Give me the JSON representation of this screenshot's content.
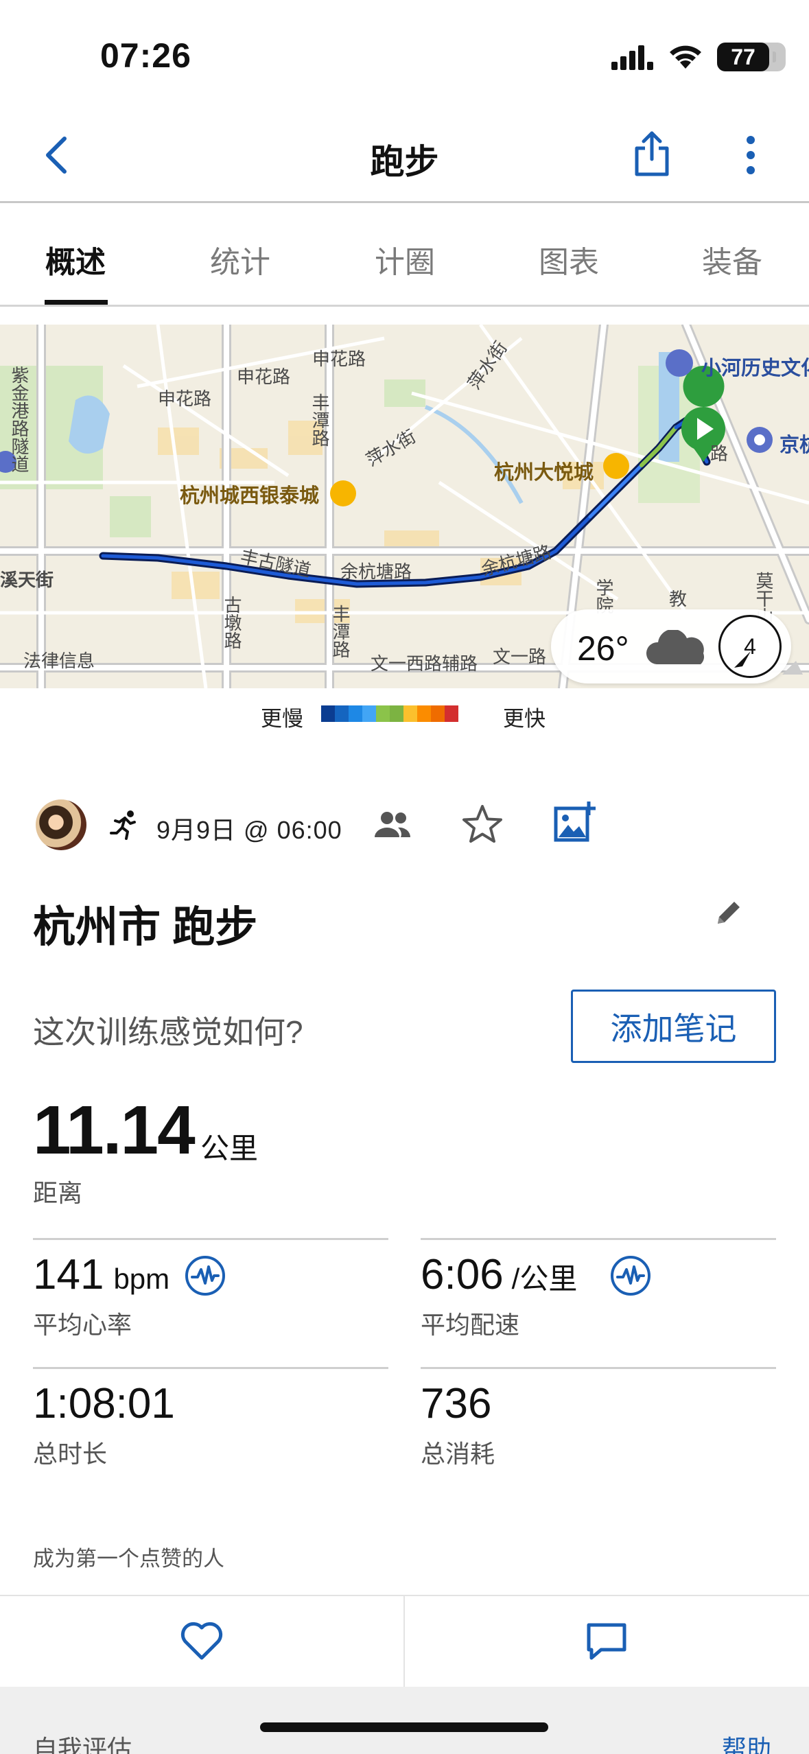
{
  "status_bar": {
    "time": "07:26",
    "battery": "77",
    "icons": [
      "signal-icon",
      "wifi-icon",
      "battery-icon"
    ]
  },
  "nav": {
    "title": "跑步",
    "back_icon": "chevron-left-icon",
    "share_icon": "share-icon",
    "more_icon": "more-vertical-icon"
  },
  "tabs": [
    {
      "label": "概述",
      "active": true
    },
    {
      "label": "统计",
      "active": false
    },
    {
      "label": "计圈",
      "active": false
    },
    {
      "label": "图表",
      "active": false
    },
    {
      "label": "装备",
      "active": false
    }
  ],
  "map": {
    "labels": {
      "road1": "申花路",
      "road2": "申花路",
      "road3": "申花路",
      "road4": "紫金港路隧道",
      "road5": "丰潭路",
      "road6": "萍水街",
      "road7": "萍水街",
      "road8": "丰古隧道",
      "road9": "余杭塘路",
      "road10": "余杭塘路",
      "road11": "古墩路",
      "road12": "丰潭路",
      "road13": "文一西路辅路",
      "road14": "文一路",
      "road15": "溪天街",
      "road16": "法律信息",
      "road17": "学院",
      "road18": "教",
      "road19": "莫干山路",
      "road20": "路"
    },
    "pois": {
      "poi1": "杭州城西银泰城",
      "poi2": "杭州大悦城",
      "poi3": "小河历史文化",
      "poi4": "京杭"
    },
    "weather": {
      "temp": "26°",
      "wind": "4",
      "icon": "cloud-icon"
    }
  },
  "legend": {
    "slow": "更慢",
    "fast": "更快",
    "colors": [
      "#0b3d91",
      "#1565c0",
      "#1e88e5",
      "#42a5f5",
      "#8bc34a",
      "#7cb342",
      "#fbc02d",
      "#fb8c00",
      "#ef6c00",
      "#d32f2f"
    ]
  },
  "activity": {
    "date": "9月9日 @ 06:00",
    "title": "杭州市 跑步",
    "feel_question": "这次训练感觉如何?",
    "add_note": "添加笔记"
  },
  "distance": {
    "value": "11.14",
    "unit": "公里",
    "label": "距离"
  },
  "stats": [
    {
      "value": "141",
      "unit": "bpm",
      "label": "平均心率",
      "icon": "pulse-icon"
    },
    {
      "value": "6:06",
      "unit": "/公里",
      "label": "平均配速",
      "icon": "pulse-icon"
    },
    {
      "value": "1:08:01",
      "unit": "",
      "label": "总时长"
    },
    {
      "value": "736",
      "unit": "",
      "label": "总消耗"
    }
  ],
  "social": {
    "likes_text": "成为第一个点赞的人"
  },
  "footer": {
    "self_eval": "自我评估",
    "help": "帮助"
  }
}
